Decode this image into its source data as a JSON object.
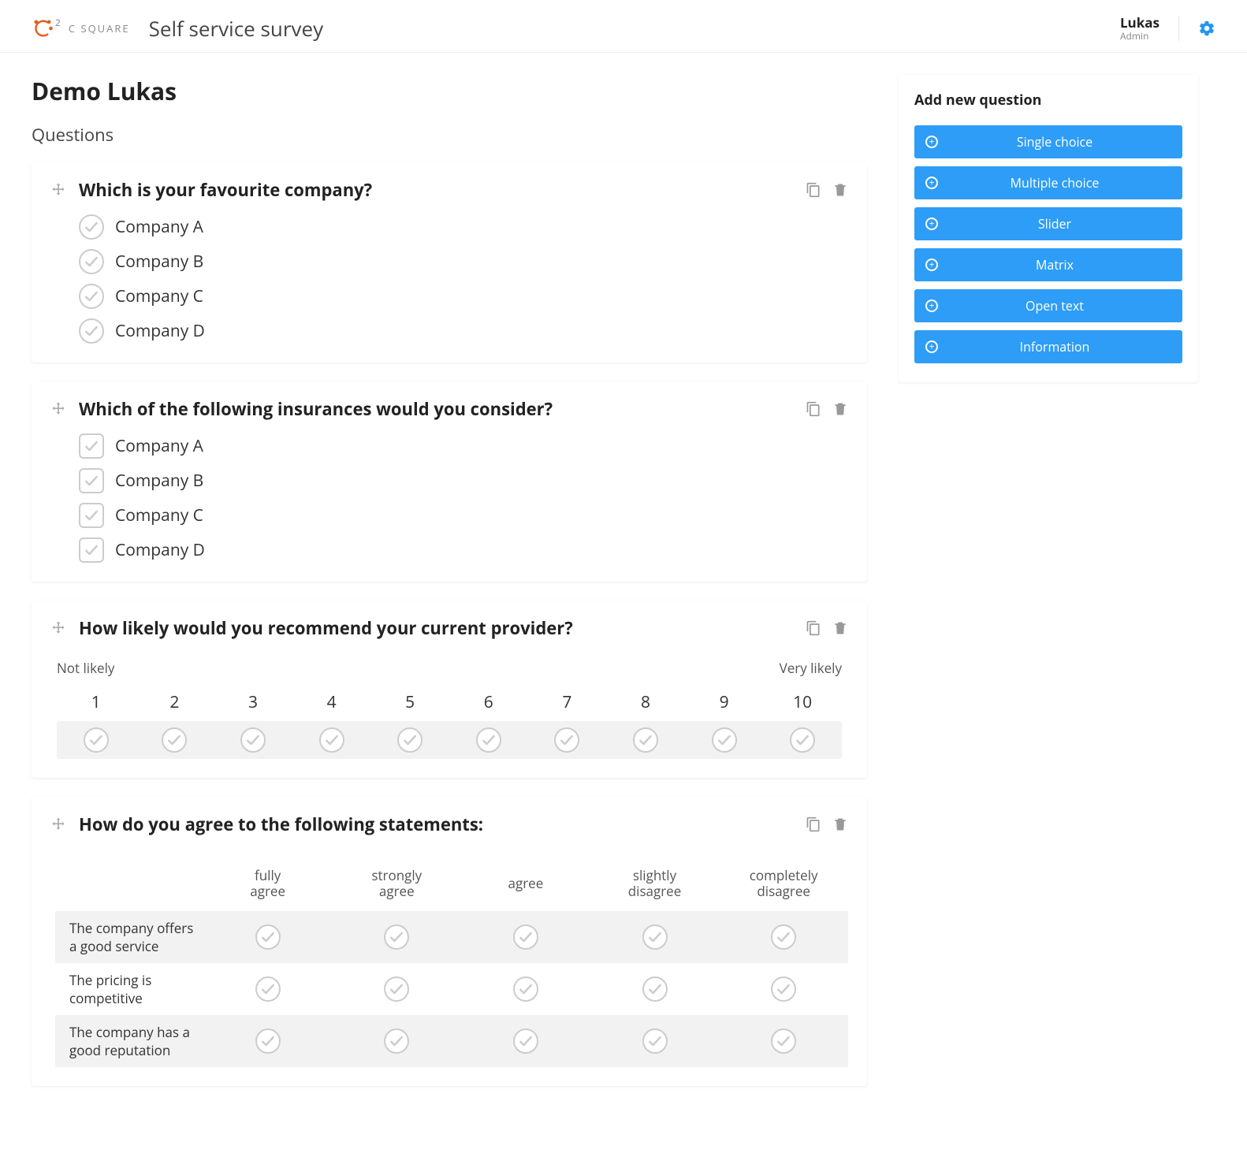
{
  "header": {
    "brand_text": "C SQUARE",
    "app_title": "Self service survey",
    "user_name": "Lukas",
    "user_role": "Admin"
  },
  "page": {
    "title": "Demo Lukas",
    "section_label": "Questions"
  },
  "sidebar": {
    "title": "Add new question",
    "buttons": [
      {
        "label": "Single choice"
      },
      {
        "label": "Multiple choice"
      },
      {
        "label": "Slider"
      },
      {
        "label": "Matrix"
      },
      {
        "label": "Open text"
      },
      {
        "label": "Information"
      }
    ]
  },
  "questions": [
    {
      "type": "single",
      "title": "Which is your favourite company?",
      "options": [
        "Company A",
        "Company B",
        "Company C",
        "Company D"
      ]
    },
    {
      "type": "multi",
      "title": "Which of the following insurances would you consider?",
      "options": [
        "Company A",
        "Company B",
        "Company C",
        "Company D"
      ]
    },
    {
      "type": "slider",
      "title": "How likely would you recommend your current provider?",
      "low_label": "Not likely",
      "high_label": "Very likely",
      "scale": [
        "1",
        "2",
        "3",
        "4",
        "5",
        "6",
        "7",
        "8",
        "9",
        "10"
      ]
    },
    {
      "type": "matrix",
      "title": "How do you agree to the following statements:",
      "columns": [
        "fully agree",
        "strongly agree",
        "agree",
        "slightly disagree",
        "completely disagree"
      ],
      "rows": [
        "The company offers a good service",
        "The pricing is competitive",
        "The company has a good reputation"
      ]
    }
  ]
}
